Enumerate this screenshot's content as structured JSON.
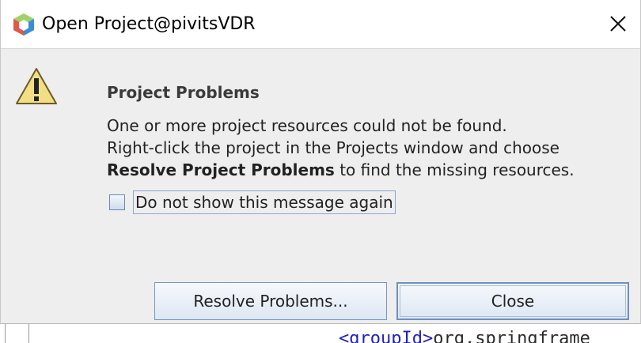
{
  "window": {
    "title": "Open Project@pivitsVDR"
  },
  "dialog": {
    "heading": "Project Problems",
    "line1": "One or more project resources could not be found.",
    "line2": "Right-click the project in the Projects window and choose",
    "line3_bold": "Resolve Project Problems",
    "line3_rest": " to find the missing resources.",
    "checkbox_label": "Do not show this message again",
    "checkbox_checked": false
  },
  "buttons": {
    "resolve_label": "Resolve Problems...",
    "close_label": "Close"
  },
  "background_editor": {
    "tag_text": "<groupId>",
    "value_text": "org.springframe"
  },
  "icons": {
    "app": "netbeans-cube-icon",
    "warning": "warning-triangle-icon",
    "close": "close-x-icon"
  },
  "colors": {
    "warning_fill": "#f3df83",
    "button_border": "#7a96bc",
    "dialog_bg": "#eeeeee"
  }
}
